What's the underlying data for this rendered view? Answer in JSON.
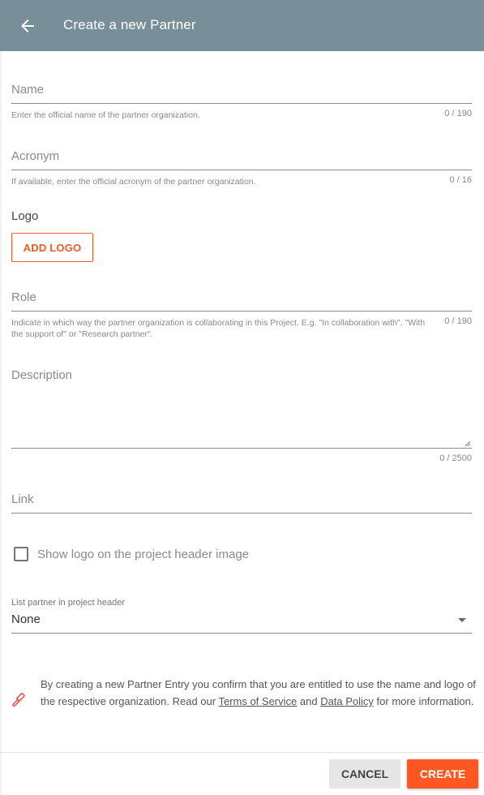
{
  "header": {
    "title": "Create a new Partner",
    "back_icon": "arrow-left-icon",
    "background_color": "#788f9a"
  },
  "form": {
    "name": {
      "label": "Name",
      "value": "",
      "hint": "Enter the official name of the partner organization.",
      "counter": "0 / 190"
    },
    "acronym": {
      "label": "Acronym",
      "value": "",
      "hint": "If available, enter the official acronym of the partner organization.",
      "counter": "0 / 16"
    },
    "logo": {
      "label": "Logo",
      "button_label": "ADD LOGO"
    },
    "role": {
      "label": "Role",
      "value": "",
      "hint": "Indicate in which way the partner organization is collaborating in this Project. E.g. \"In collaboration with\", \"With the support of\" or \"Research partner\".",
      "counter": "0 / 190"
    },
    "description": {
      "label": "Description",
      "value": "",
      "counter": "0 / 2500"
    },
    "link": {
      "label": "Link",
      "value": ""
    },
    "show_logo_checkbox": {
      "label": "Show logo on the project header image",
      "checked": false
    },
    "list_partner_select": {
      "label": "List partner in project header",
      "selected": "None"
    }
  },
  "notice": {
    "icon": "gavel-icon",
    "text_before": "By creating a new Partner Entry you confirm that you are entitled to use the name and logo of the respective organization. Read our ",
    "terms_link": "Terms of Service",
    "text_middle": " and ",
    "policy_link": "Data Policy",
    "text_after": " for more information."
  },
  "footer": {
    "cancel_label": "CANCEL",
    "create_label": "CREATE",
    "accent_color": "#ff5722"
  }
}
